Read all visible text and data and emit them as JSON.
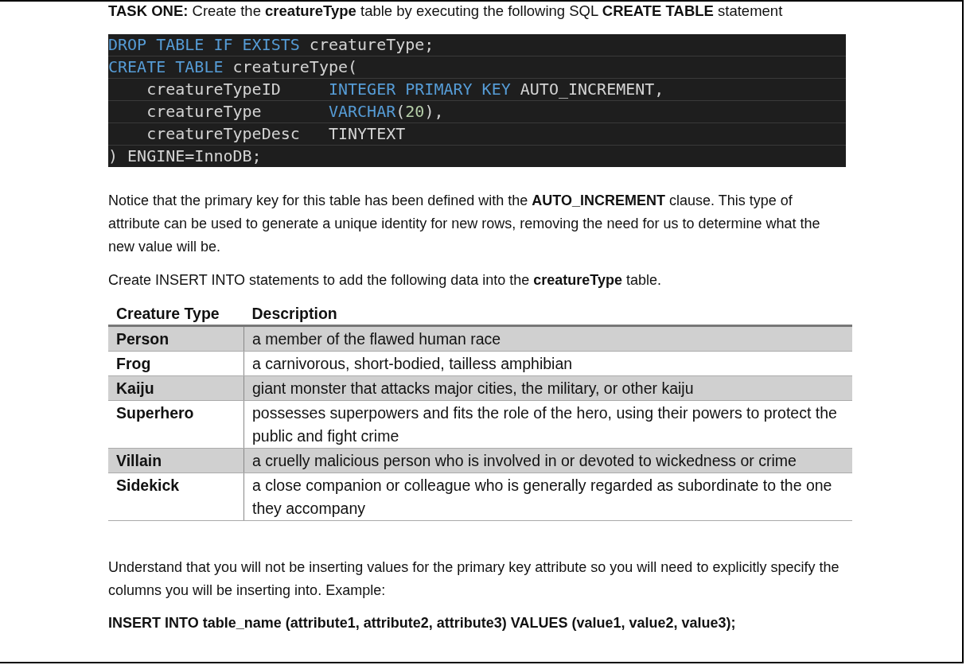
{
  "task_heading": "**TASK ONE:** Create the **creatureType** table by executing the following SQL **CREATE TABLE** statement",
  "code_lines": [
    [
      {
        "text": "DROP TABLE IF EXISTS",
        "kind": "keyword"
      },
      {
        "text": " creatureType;",
        "kind": "plain"
      }
    ],
    [
      {
        "text": "CREATE TABLE",
        "kind": "keyword"
      },
      {
        "text": " creatureType(",
        "kind": "plain"
      }
    ],
    [
      {
        "text": "    creatureTypeID     ",
        "kind": "plain"
      },
      {
        "text": "INTEGER PRIMARY KEY",
        "kind": "keyword"
      },
      {
        "text": " AUTO_INCREMENT,",
        "kind": "plain"
      }
    ],
    [
      {
        "text": "    creatureType       ",
        "kind": "plain"
      },
      {
        "text": "VARCHAR",
        "kind": "keyword"
      },
      {
        "text": "(",
        "kind": "plain"
      },
      {
        "text": "20",
        "kind": "number"
      },
      {
        "text": "),",
        "kind": "plain"
      }
    ],
    [
      {
        "text": "    creatureTypeDesc   ",
        "kind": "plain"
      },
      {
        "text": "TINYTEXT",
        "kind": "plain"
      }
    ],
    [
      {
        "text": ") ENGINE=InnoDB;",
        "kind": "plain"
      }
    ]
  ],
  "paragraphs_before": [
    "Notice that the primary key for this table has been defined with the **AUTO_INCREMENT** clause. This type of attribute can be used to generate a unique identity for new rows, removing the need for us to determine what the new value will be.",
    "Create INSERT INTO statements to add the following data into the **creatureType** table."
  ],
  "table": {
    "columns": [
      "Creature Type",
      "Description"
    ],
    "rows": [
      {
        "type": "Person",
        "description": "a member of the flawed human race"
      },
      {
        "type": "Frog",
        "description": "a carnivorous, short-bodied, tailless amphibian"
      },
      {
        "type": "Kaiju",
        "description": "giant monster that attacks major cities, the military, or other kaiju"
      },
      {
        "type": "Superhero",
        "description": "possesses superpowers and fits the role of the hero, using their powers to protect the public and fight crime"
      },
      {
        "type": "Villain",
        "description": "a cruelly malicious person who is involved in or devoted to wickedness or crime"
      },
      {
        "type": "Sidekick",
        "description": "a close companion or colleague who is generally regarded as subordinate to the one they accompany"
      }
    ]
  },
  "paragraphs_after": [
    "Understand that you will not be inserting values for the primary key attribute so you will need to explicitly specify the columns you will be inserting into. Example:"
  ],
  "example_statement": "INSERT INTO table_name (attribute1, attribute2, attribute3) VALUES (value1, value2, value3);"
}
